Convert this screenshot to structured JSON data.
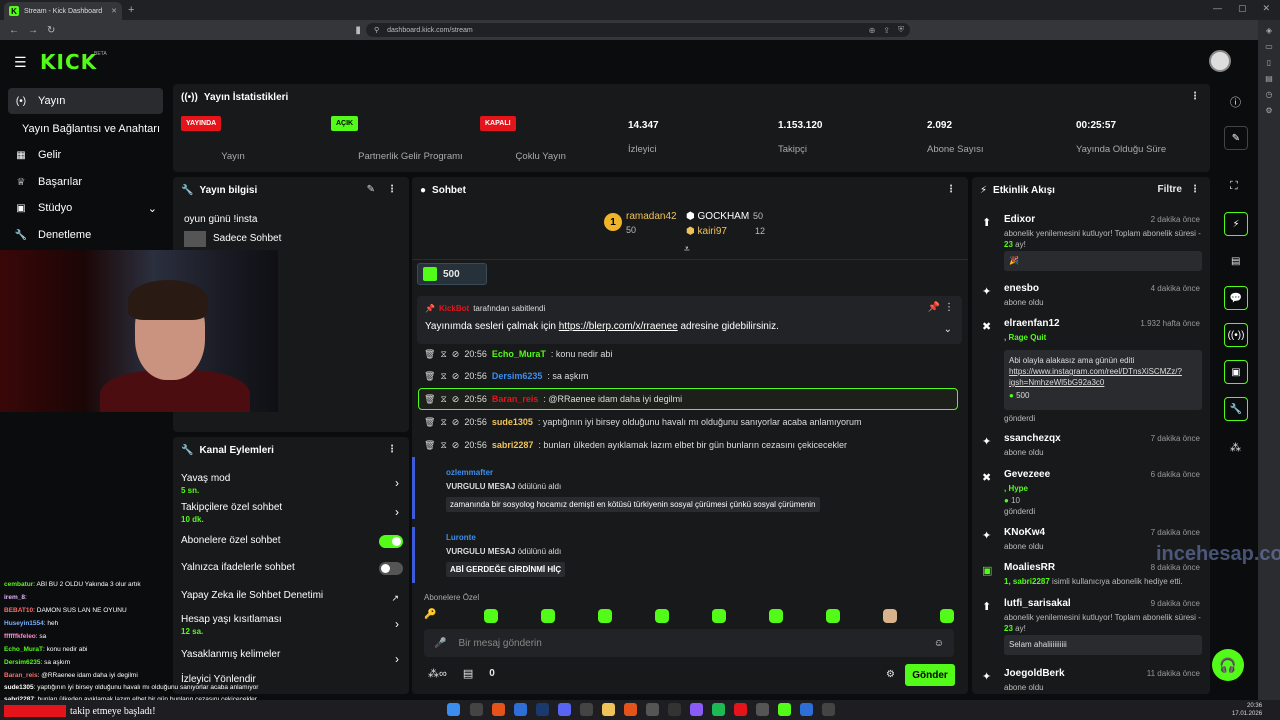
{
  "browser": {
    "tab_title": "Stream - Kick Dashboard",
    "url": "dashboard.kick.com/stream"
  },
  "header": {
    "logo": "KICK",
    "beta": "BETA"
  },
  "sidebar": {
    "items": [
      {
        "label": "Yayın",
        "icon": "broadcast-icon"
      },
      {
        "label": "Yayın Bağlantısı ve Anahtarı",
        "icon": ""
      },
      {
        "label": "Gelir",
        "icon": "bank-icon"
      },
      {
        "label": "Başarılar",
        "icon": "trophy-icon"
      },
      {
        "label": "Stüdyo",
        "icon": "studio-icon"
      },
      {
        "label": "Denetleme",
        "icon": "wrench-icon"
      }
    ]
  },
  "stats": {
    "title": "Yayın İstatistikleri",
    "items": [
      {
        "badge": "YAYINDA",
        "label": "Yayın"
      },
      {
        "badge": "AÇIK",
        "label": "Partnerlik Gelir Programı"
      },
      {
        "badge": "KAPALI",
        "label": "Çoklu Yayın"
      },
      {
        "value": "14.347",
        "label": "İzleyici"
      },
      {
        "value": "1.153.120",
        "label": "Takipçi"
      },
      {
        "value": "2.092",
        "label": "Abone Sayısı"
      },
      {
        "value": "00:25:57",
        "label": "Yayında Olduğu Süre"
      }
    ]
  },
  "stream_info": {
    "title": "Yayın bilgisi",
    "stream_title": "oyun günü !insta",
    "category": "Sadece Sohbet"
  },
  "channel_actions": {
    "title": "Kanal Eylemleri",
    "items": [
      {
        "label": "Yavaş mod",
        "sub": "5 sn."
      },
      {
        "label": "Takipçilere özel sohbet",
        "sub": "10 dk."
      },
      {
        "label": "Abonelere özel sohbet",
        "toggle": "on"
      },
      {
        "label": "Yalnızca ifadelerle sohbet",
        "toggle": "off"
      },
      {
        "label": "Yapay Zeka ile Sohbet Denetimi"
      },
      {
        "label": "Hesap yaşı kısıtlaması",
        "sub": "12 sa."
      },
      {
        "label": "Yasaklanmış kelimeler"
      },
      {
        "label": "İzleyici Yönlendir"
      }
    ]
  },
  "chat": {
    "title": "Sohbet",
    "leaders": [
      {
        "name": "ramadan42",
        "count": "50",
        "rank": "1"
      },
      {
        "name": "GOCKHAM",
        "count": "50"
      },
      {
        "name": "kairi97",
        "count": "12"
      }
    ],
    "gift": "500",
    "pinned": {
      "by": "KickBot",
      "by_suffix": "tarafından sabitlendi",
      "text_before": "Yayınımda sesleri çalmak için ",
      "link": "https://blerp.com/x/rraenee",
      "text_after": " adresine gidebilirsiniz."
    },
    "messages": [
      {
        "time": "20:56",
        "user": "Echo_MuraT",
        "text": ": konu nedir abi",
        "color": "#53fc18"
      },
      {
        "time": "20:56",
        "user": "Dersim6235",
        "text": ": sa aşkım",
        "color": "#3b8ef0"
      },
      {
        "time": "20:56",
        "user": "Baran_reis",
        "text": ": @RRaenee idam daha iyi degilmi",
        "color": "#e4141a"
      },
      {
        "time": "20:56",
        "user": "sude1305",
        "text": ": yaptığının iyi birsey olduğunu havalı mı olduğunu sanıyorlar acaba anlamıyorum",
        "color": "#f0c35a"
      },
      {
        "time": "20:56",
        "user": "sabri2287",
        "text": ": bunları ülkeden ayıklamak lazım elbet bir gün bunların cezasını çekicecekler",
        "color": "#f0c35a"
      }
    ],
    "rewards": [
      {
        "user": "ozlemmafter",
        "title": "VURGULU MESAJ",
        "suffix": "ödülünü aldı",
        "text": "zamanında bir sosyolog hocamız demişti en kötüsü türkiyenin sosyal çürümesi çünkü sosyal çürümenin"
      },
      {
        "user": "Luronte",
        "title": "VURGULU MESAJ",
        "suffix": "ödülünü aldı",
        "text": "ABİ GERDEĞE GİRDİNMİ HİÇ"
      }
    ],
    "emote_tab": "Abonelere Özel",
    "input_placeholder": "Bir mesaj gönderin",
    "count": "0",
    "send": "Gönder"
  },
  "activity": {
    "title": "Etkinlik Akışı",
    "filter": "Filtre",
    "items": [
      {
        "name": "Edixor",
        "time": "2 dakika önce",
        "sub_a": "abonelik yenilemesini kutluyor! Toplam abonelik süresi - ",
        "sub_b": "23",
        "sub_c": " ay!",
        "box": "🎉"
      },
      {
        "name": "enesbo",
        "time": "4 dakika önce",
        "sub": "abone oldu"
      },
      {
        "name": "elraenfan12",
        "time": "1.932 hafta önce",
        "tag": ", Rage Quit",
        "box": "Abi olayla alakasız ama günün editi",
        "link": "https://www.instagram.com/reel/DTnsXiSCMZz/?igsh=NmhzeWl5bG92a3c0",
        "amount": "500",
        "sub": "gönderdi"
      },
      {
        "name": "ssanchezqx",
        "time": "7 dakika önce",
        "sub": "abone oldu"
      },
      {
        "name": "Gevezeee",
        "time": "6 dakika önce",
        "tag": ", Hype",
        "amount": "10",
        "sub": "gönderdi"
      },
      {
        "name": "KNoKw4",
        "time": "7 dakika önce",
        "sub": "abone oldu"
      },
      {
        "name": "MoaliesRR",
        "time": "8 dakika önce",
        "sub_a": "1, sabri2287",
        "sub_c": " isimli kullanıcıya abonelik hediye etti."
      },
      {
        "name": "lutfi_sarisakal",
        "time": "9 dakika önce",
        "sub_a": "abonelik yenilemesini kutluyor! Toplam abonelik süresi - ",
        "sub_b": "23",
        "sub_c": " ay!",
        "box": "Selam ahaliiiiiiiiii"
      },
      {
        "name": "JoegoldBerk",
        "time": "11 dakika önce",
        "sub": "abone oldu"
      }
    ]
  },
  "overlay_chat": [
    {
      "user": "cembatur",
      "text": ": ABI BU 2 OLDU Yakında 3 olur artık",
      "color": "#53fc18"
    },
    {
      "user": "irem_8",
      "text": ":",
      "color": "#e4b4ff"
    },
    {
      "user": "BEBAT10",
      "text": ": DAMON SUS LAN NE OYUNU",
      "color": "#ff6b6b"
    },
    {
      "user": "Huseyin1554",
      "text": ": heh",
      "color": "#7ab0ff"
    },
    {
      "user": "ffffffkfeleo",
      "text": ": sa",
      "color": "#ff8ad0"
    },
    {
      "user": "Echo_MuraT",
      "text": ": konu nedir abi",
      "color": "#53fc18"
    },
    {
      "user": "Dersim6235",
      "text": ": sa aşkım",
      "color": "#53fc18"
    },
    {
      "user": "Baran_reis",
      "text": ": @RRaenee idam daha iyi degilmi",
      "color": "#ff6b6b"
    },
    {
      "user": "sude1305",
      "text": ": yaptığının iyi birsey olduğunu havalı mı olduğunu sanıyorlar acaba anlamıyor",
      "color": "#ffffff"
    },
    {
      "user": "sabri2287",
      "text": ": bunları ülkeden ayıklamak lazım elbet bir gün bunların cezasını çekicecekler",
      "color": "#ffffff"
    }
  ],
  "overlay_follow": "takip etmeye başladı!",
  "watermark": "incehesap.com",
  "clock": {
    "time": "20:36",
    "date": "17.01.2026"
  },
  "colors": {
    "accent": "#53fc18",
    "danger": "#e4141a",
    "panel": "#18191b"
  }
}
